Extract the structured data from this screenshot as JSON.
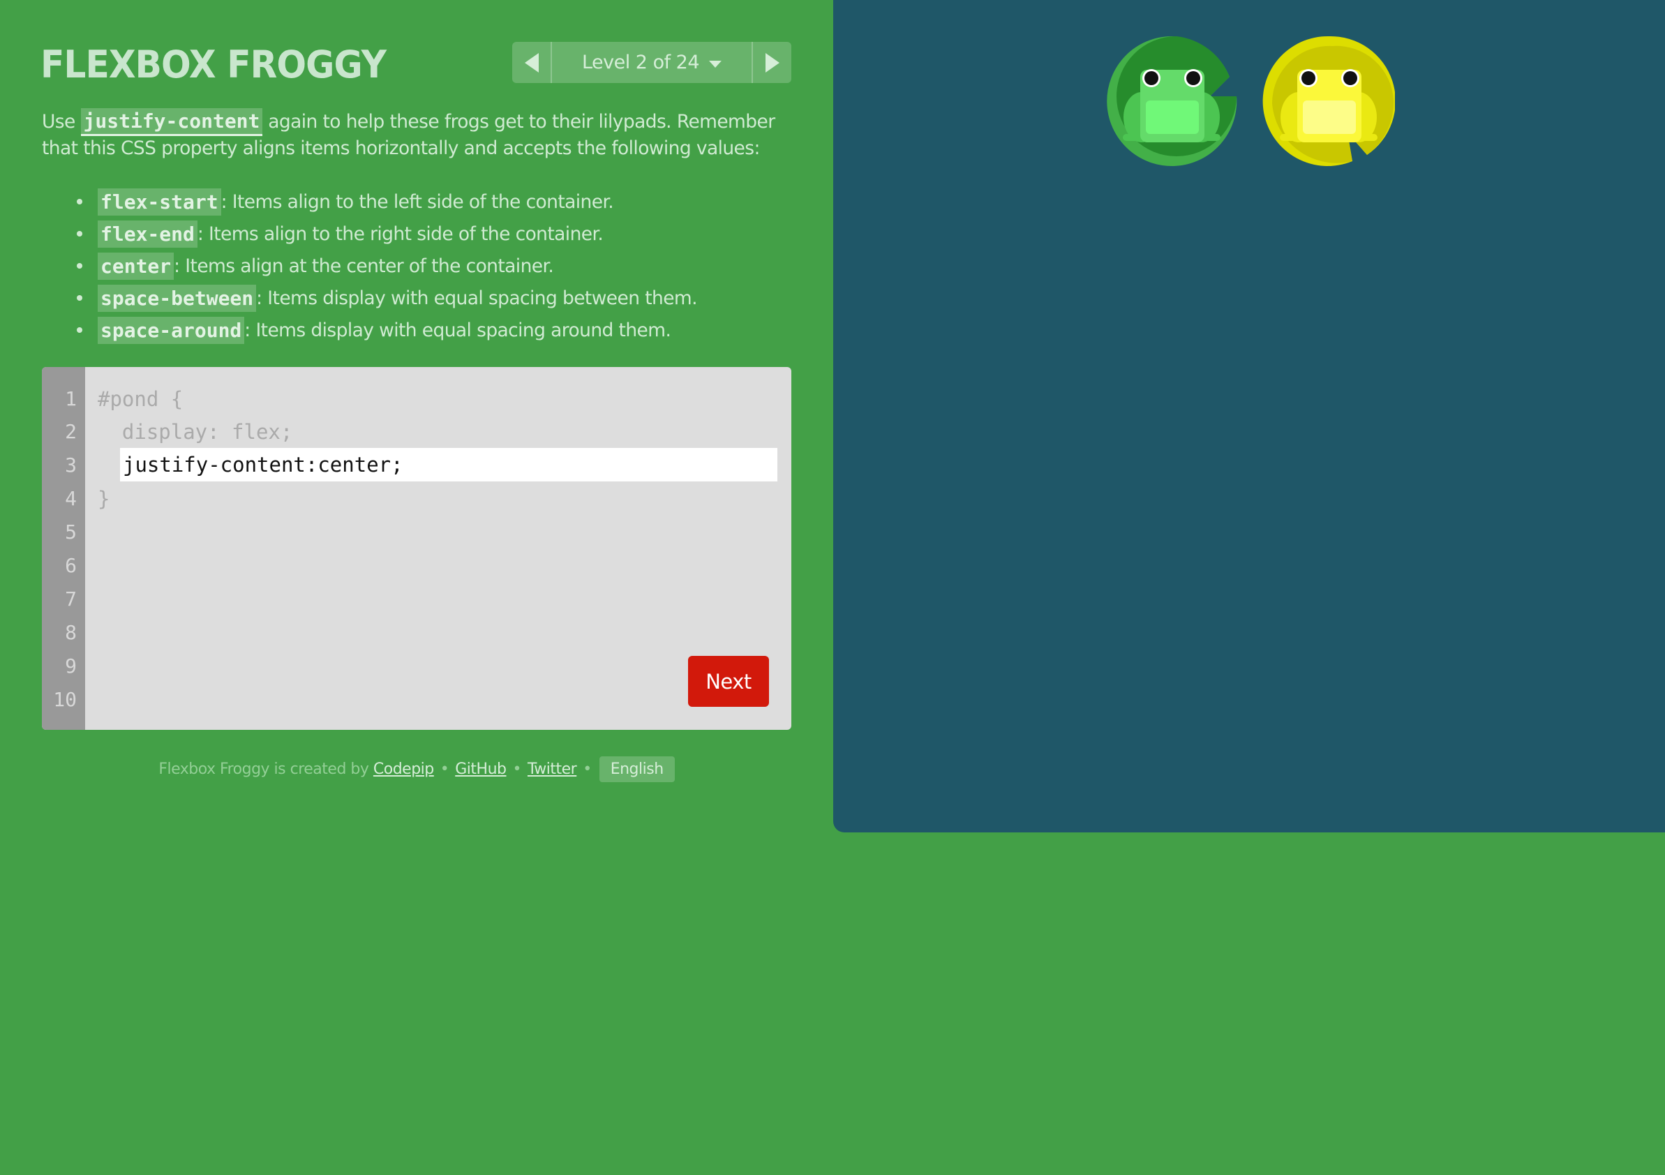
{
  "header": {
    "title": "FLEXBOX FROGGY",
    "level_label": "Level 2 of 24",
    "level_current": 2,
    "level_total": 24,
    "prev_icon": "triangle-left-icon",
    "next_icon": "triangle-right-icon",
    "dropdown_icon": "caret-down-icon"
  },
  "instructions": {
    "prefix": "Use ",
    "property": "justify-content",
    "suffix": " again to help these frogs get to their lilypads. Remember that this CSS property aligns items horizontally and accepts the following values:",
    "values": [
      {
        "code": "flex-start",
        "desc": ": Items align to the left side of the container."
      },
      {
        "code": "flex-end",
        "desc": ": Items align to the right side of the container."
      },
      {
        "code": "center",
        "desc": ": Items align at the center of the container."
      },
      {
        "code": "space-between",
        "desc": ": Items display with equal spacing between them."
      },
      {
        "code": "space-around",
        "desc": ": Items display with equal spacing around them."
      }
    ]
  },
  "editor": {
    "line_numbers": [
      "1",
      "2",
      "3",
      "4",
      "5",
      "6",
      "7",
      "8",
      "9",
      "10"
    ],
    "line1": "#pond {",
    "line2": "  display: flex;",
    "input_value": "justify-content:center;",
    "line4": "}",
    "next_label": "Next"
  },
  "footer": {
    "credit_text": "Flexbox Froggy is created by ",
    "links": [
      "Codepip",
      "GitHub",
      "Twitter"
    ],
    "separator": "•",
    "language": "English"
  },
  "pond": {
    "frogs": [
      {
        "color": "green",
        "lilypad": "green"
      },
      {
        "color": "yellow",
        "lilypad": "yellow"
      }
    ],
    "colors": {
      "water": "#1f5768",
      "green_pad": "#268c2c",
      "green_pad_rim": "#43b048",
      "green_frog_body": "#64db6a",
      "green_frog_belly": "#70f878",
      "green_frog_legs": "#4cc552",
      "yellow_pad": "#c9c700",
      "yellow_pad_rim": "#dddd00",
      "yellow_frog_body": "#fbf83a",
      "yellow_frog_belly": "#fdfd88",
      "yellow_frog_legs": "#eae912"
    }
  },
  "colors": {
    "background": "#43a047",
    "editor_bg": "#dddddd",
    "gutter_bg": "#999999",
    "next_button": "#d2190b"
  }
}
